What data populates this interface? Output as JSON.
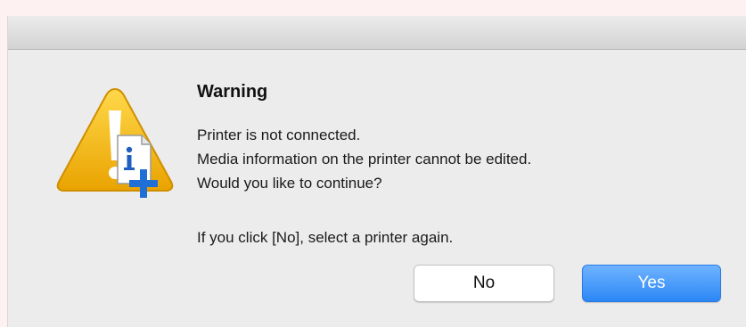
{
  "dialog": {
    "title": "Warning",
    "messages": [
      "Printer is not connected.",
      "Media information on the printer cannot be edited.",
      "Would you like to continue?"
    ],
    "note": "If you click [No], select a printer again.",
    "icon": "warning-document-info-icon"
  },
  "buttons": {
    "no_label": "No",
    "yes_label": "Yes"
  },
  "colors": {
    "accent": "#2b87f5",
    "warning": "#f5b800",
    "background": "#ececec"
  }
}
